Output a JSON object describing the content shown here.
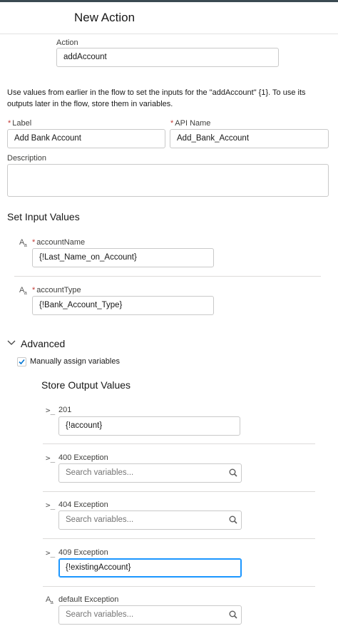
{
  "header": {
    "title": "New Action"
  },
  "action": {
    "label": "Action",
    "value": "addAccount"
  },
  "description_text": "Use values from earlier in the flow to set the inputs for the \"addAccount\" {1}. To use its outputs later in the flow, store them in variables.",
  "fields": {
    "label": {
      "required": "*",
      "label": "Label",
      "value": "Add Bank Account"
    },
    "api_name": {
      "required": "*",
      "label": "API Name",
      "value": "Add_Bank_Account"
    },
    "description": {
      "label": "Description",
      "value": ""
    }
  },
  "set_input": {
    "title": "Set Input Values",
    "inputs": [
      {
        "icon": "text-type-icon",
        "required": "*",
        "label": "accountName",
        "value": "{!Last_Name_on_Account}"
      },
      {
        "icon": "text-type-icon",
        "required": "*",
        "label": "accountType",
        "value": "{!Bank_Account_Type}"
      }
    ]
  },
  "advanced": {
    "title": "Advanced",
    "expanded": true,
    "manual_label": "Manually assign variables",
    "manual_checked": true
  },
  "store_output": {
    "title": "Store Output Values",
    "outputs": [
      {
        "icon": "prompt-icon",
        "prompt": ">_",
        "label": "201",
        "value": "{!account}",
        "placeholder": ""
      },
      {
        "icon": "prompt-icon",
        "prompt": ">_",
        "label": "400 Exception",
        "value": "",
        "placeholder": "Search variables..."
      },
      {
        "icon": "prompt-icon",
        "prompt": ">_",
        "label": "404 Exception",
        "value": "",
        "placeholder": "Search variables..."
      },
      {
        "icon": "prompt-icon",
        "prompt": ">_",
        "label": "409 Exception",
        "value": "{!existingAccount}",
        "placeholder": ""
      },
      {
        "icon": "text-type-icon",
        "prompt": "",
        "label": "default Exception",
        "value": "",
        "placeholder": "Search variables..."
      }
    ]
  },
  "colors": {
    "focus": "#1b96ff",
    "required": "#c23934",
    "check": "#0176d3"
  }
}
